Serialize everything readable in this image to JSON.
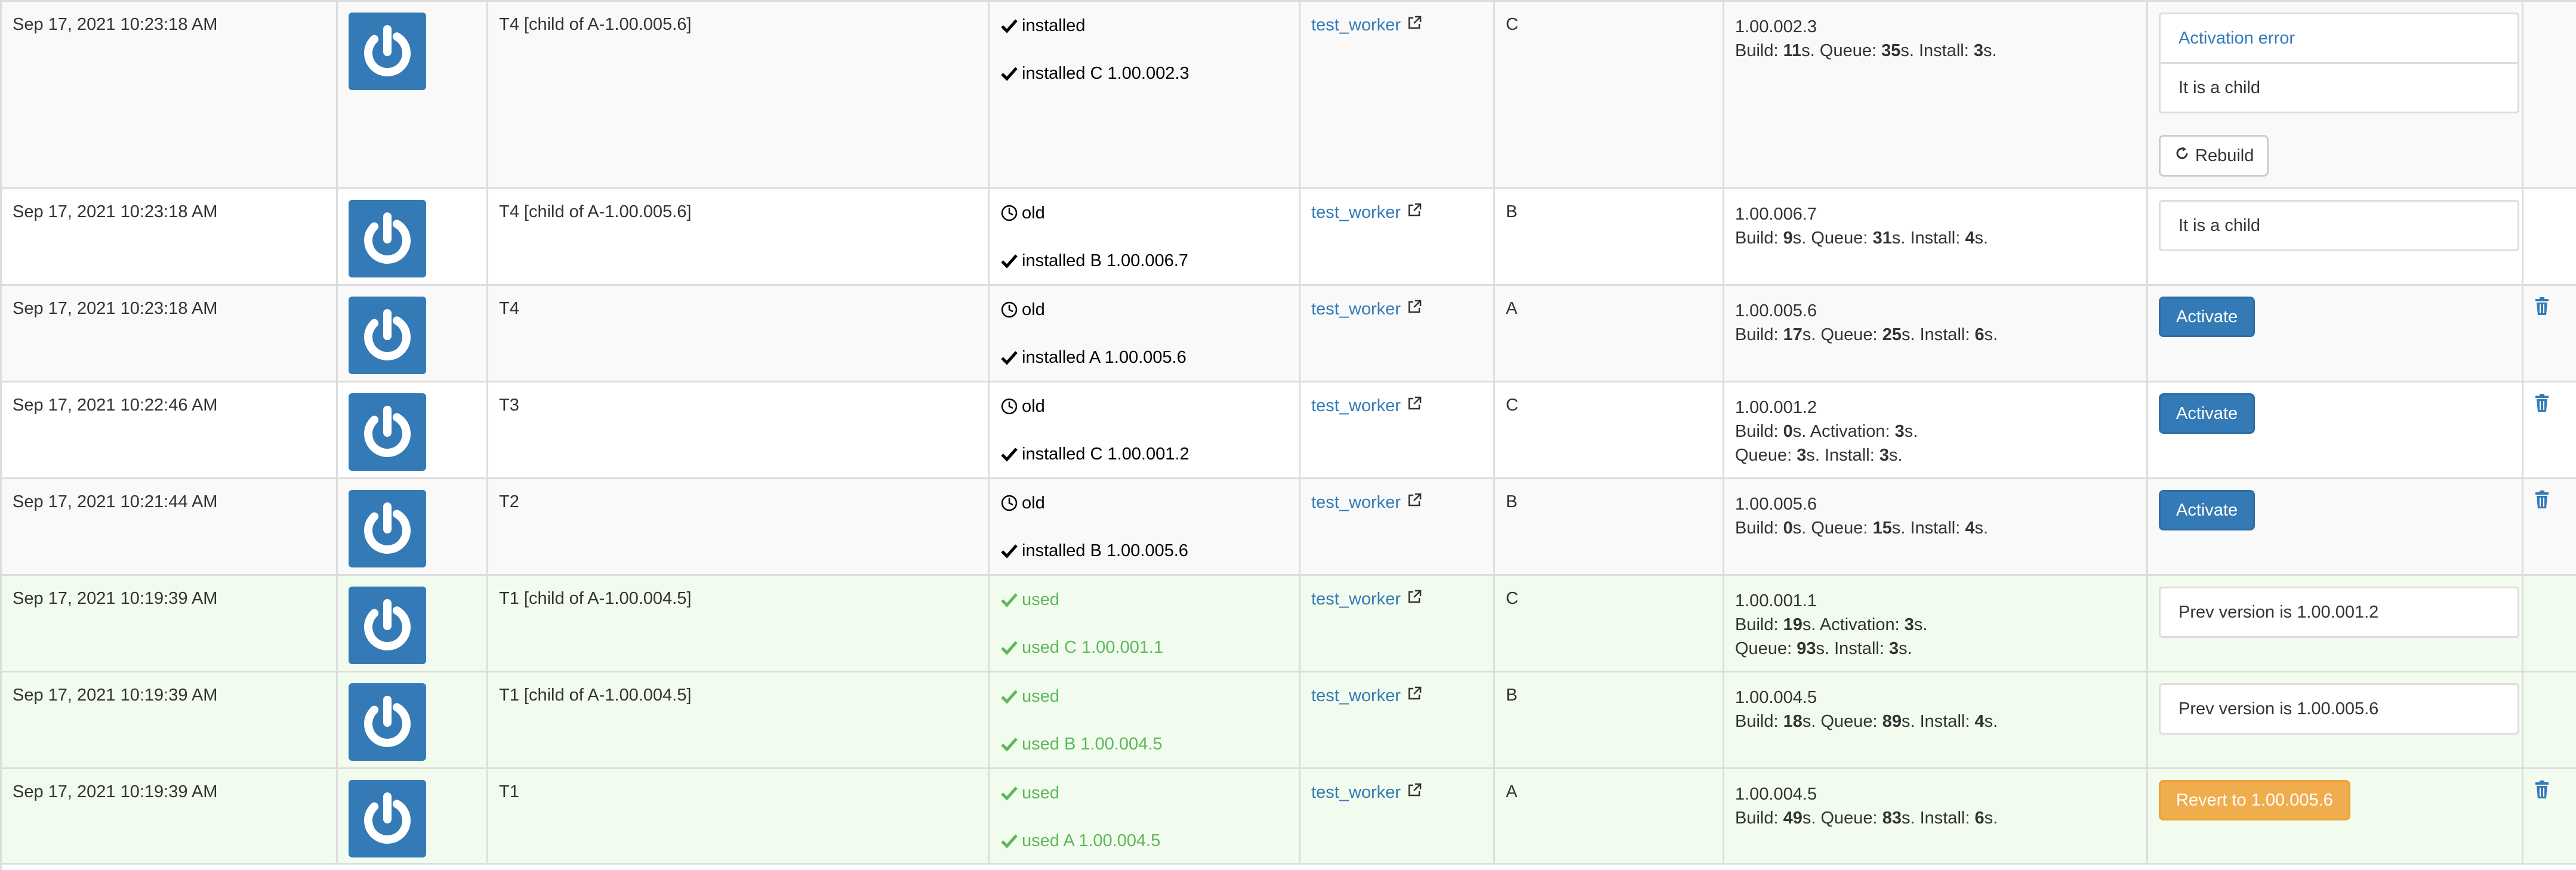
{
  "rows": [
    {
      "date": "Sep 17, 2021 10:23:18 AM",
      "name": "T4 [child of A-1.00.005.6]",
      "status1": {
        "icon": "check-icon",
        "text": "installed"
      },
      "status2": {
        "icon": "check-icon",
        "text": "installed C 1.00.002.3"
      },
      "worker": "test_worker",
      "group": "C",
      "version": "1.00.002.3",
      "times_line1": [
        [
          "Build: ",
          "11",
          "s. Queue: "
        ],
        [
          "35",
          "s. Install: "
        ],
        [
          "3",
          "s."
        ]
      ],
      "action_panel_heading": "Activation error",
      "action_panel_text": "It is a child",
      "rebuild_label": "Rebuild"
    },
    {
      "date": "Sep 17, 2021 10:23:18 AM",
      "name": "T4 [child of A-1.00.005.6]",
      "status1": {
        "icon": "clock-icon",
        "text": "old"
      },
      "status2": {
        "icon": "check-icon",
        "text": "installed B 1.00.006.7"
      },
      "worker": "test_worker",
      "group": "B",
      "version": "1.00.006.7",
      "action_panel_text": "It is a child"
    },
    {
      "date": "Sep 17, 2021 10:23:18 AM",
      "name": "T4",
      "status1": {
        "icon": "clock-icon",
        "text": "old"
      },
      "status2": {
        "icon": "check-icon",
        "text": "installed A 1.00.005.6"
      },
      "worker": "test_worker",
      "group": "A",
      "version": "1.00.005.6",
      "action_button": "Activate"
    },
    {
      "date": "Sep 17, 2021 10:22:46 AM",
      "name": "T3",
      "status1": {
        "icon": "clock-icon",
        "text": "old"
      },
      "status2": {
        "icon": "check-icon",
        "text": "installed C 1.00.001.2"
      },
      "worker": "test_worker",
      "group": "C",
      "version": "1.00.001.2",
      "action_button": "Activate"
    },
    {
      "date": "Sep 17, 2021 10:21:44 AM",
      "name": "T2",
      "status1": {
        "icon": "clock-icon",
        "text": "old"
      },
      "status2": {
        "icon": "check-icon",
        "text": "installed B 1.00.005.6"
      },
      "worker": "test_worker",
      "group": "B",
      "version": "1.00.005.6",
      "action_button": "Activate"
    },
    {
      "date": "Sep 17, 2021 10:19:39 AM",
      "name": "T1 [child of A-1.00.004.5]",
      "status1": {
        "icon": "check-icon",
        "text": "used"
      },
      "status2": {
        "icon": "check-icon",
        "text": "used C 1.00.001.1"
      },
      "worker": "test_worker",
      "group": "C",
      "version": "1.00.001.1",
      "action_panel_text": "Prev version is 1.00.001.2"
    },
    {
      "date": "Sep 17, 2021 10:19:39 AM",
      "name": "T1 [child of A-1.00.004.5]",
      "status1": {
        "icon": "check-icon",
        "text": "used"
      },
      "status2": {
        "icon": "check-icon",
        "text": "used B 1.00.004.5"
      },
      "worker": "test_worker",
      "group": "B",
      "version": "1.00.004.5",
      "action_panel_text": "Prev version is 1.00.005.6"
    },
    {
      "date": "Sep 17, 2021 10:19:39 AM",
      "name": "T1",
      "status1": {
        "icon": "check-icon",
        "text": "used"
      },
      "status2": {
        "icon": "check-icon",
        "text": "used A 1.00.004.5"
      },
      "worker": "test_worker",
      "group": "A",
      "version": "1.00.004.5",
      "action_button": "Revert to 1.00.005.6"
    }
  ],
  "times": [
    {
      "line1": [
        {
          "t": "Build: "
        },
        {
          "b": "11"
        },
        {
          "t": "s. Queue: "
        },
        {
          "b": "35"
        },
        {
          "t": "s. Install: "
        },
        {
          "b": "3"
        },
        {
          "t": "s."
        }
      ]
    },
    {
      "line1": [
        {
          "t": "Build: "
        },
        {
          "b": "9"
        },
        {
          "t": "s. Queue: "
        },
        {
          "b": "31"
        },
        {
          "t": "s. Install: "
        },
        {
          "b": "4"
        },
        {
          "t": "s."
        }
      ]
    },
    {
      "line1": [
        {
          "t": "Build: "
        },
        {
          "b": "17"
        },
        {
          "t": "s. Queue: "
        },
        {
          "b": "25"
        },
        {
          "t": "s. Install: "
        },
        {
          "b": "6"
        },
        {
          "t": "s."
        }
      ]
    },
    {
      "line1": [
        {
          "t": "Build: "
        },
        {
          "b": "0"
        },
        {
          "t": "s. Activation: "
        },
        {
          "b": "3"
        },
        {
          "t": "s."
        }
      ],
      "line2": [
        {
          "t": "Queue: "
        },
        {
          "b": "3"
        },
        {
          "t": "s. Install: "
        },
        {
          "b": "3"
        },
        {
          "t": "s."
        }
      ]
    },
    {
      "line1": [
        {
          "t": "Build: "
        },
        {
          "b": "0"
        },
        {
          "t": "s. Queue: "
        },
        {
          "b": "15"
        },
        {
          "t": "s. Install: "
        },
        {
          "b": "4"
        },
        {
          "t": "s."
        }
      ]
    },
    {
      "line1": [
        {
          "t": "Build: "
        },
        {
          "b": "19"
        },
        {
          "t": "s. Activation: "
        },
        {
          "b": "3"
        },
        {
          "t": "s."
        }
      ],
      "line2": [
        {
          "t": "Queue: "
        },
        {
          "b": "93"
        },
        {
          "t": "s. Install: "
        },
        {
          "b": "3"
        },
        {
          "t": "s."
        }
      ]
    },
    {
      "line1": [
        {
          "t": "Build: "
        },
        {
          "b": "18"
        },
        {
          "t": "s. Queue: "
        },
        {
          "b": "89"
        },
        {
          "t": "s. Install: "
        },
        {
          "b": "4"
        },
        {
          "t": "s."
        }
      ]
    },
    {
      "line1": [
        {
          "t": "Build: "
        },
        {
          "b": "49"
        },
        {
          "t": "s. Queue: "
        },
        {
          "b": "83"
        },
        {
          "t": "s. Install: "
        },
        {
          "b": "6"
        },
        {
          "t": "s."
        }
      ]
    }
  ],
  "colors": {
    "primary": "#337ab7",
    "success": "#5cb85c",
    "warning": "#f0ad4e",
    "success_row_bg": "#f2fcee"
  },
  "icons": {
    "avatar": "power-icon",
    "delete": "trash-icon",
    "external": "external-link-icon",
    "rebuild": "refresh-icon"
  }
}
